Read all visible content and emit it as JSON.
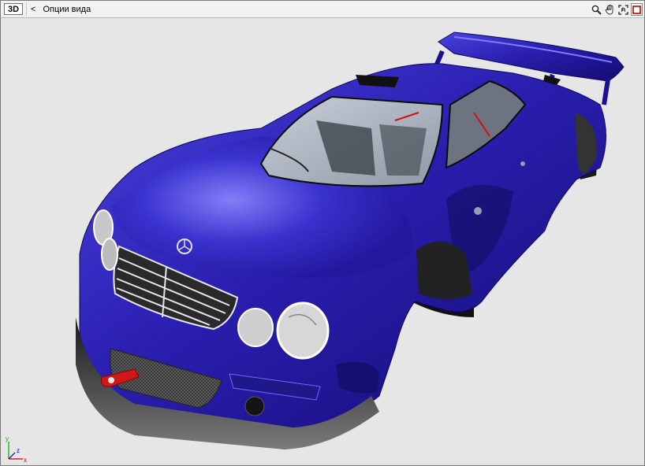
{
  "toolbar": {
    "mode_label": "3D",
    "view_options_chevron": "<",
    "view_options_label": "Опции вида",
    "tools": [
      {
        "name": "zoom-icon"
      },
      {
        "name": "pan-hand-icon"
      },
      {
        "name": "fit-view-icon"
      },
      {
        "name": "maximize-icon"
      }
    ]
  },
  "axes": {
    "y_label": "y",
    "z_label": "z",
    "x_label": "x"
  },
  "colors": {
    "toolbar_bg": "#f1f1ef",
    "viewport_bg": "#e6e6e6",
    "car_body": "#2a1fb0",
    "axis_x": "#cc0000",
    "axis_y": "#00aa00",
    "axis_z": "#0000cc"
  }
}
